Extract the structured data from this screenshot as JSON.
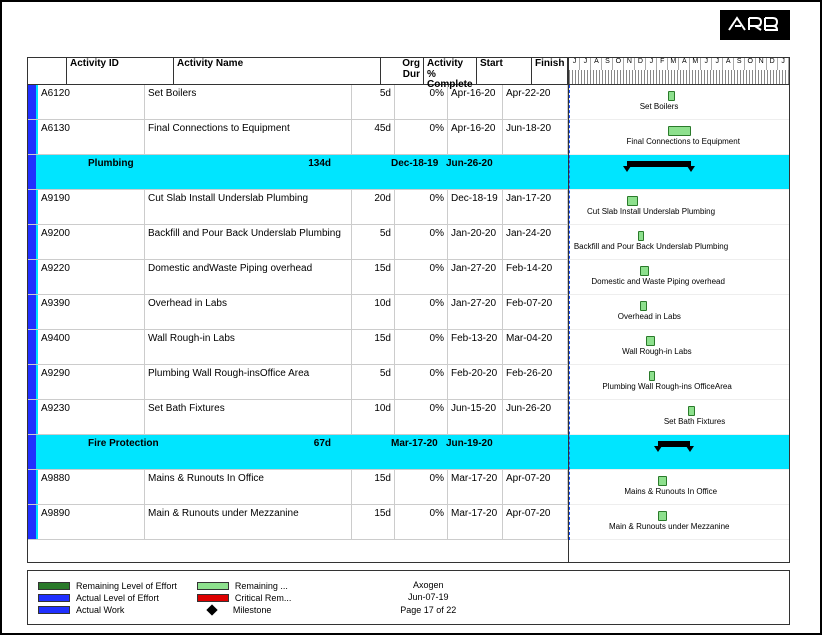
{
  "header": {
    "cols": {
      "id": "Activity ID",
      "name": "Activity Name",
      "dur": "Org Dur",
      "pct": "Activity % Complete",
      "start": "Start",
      "finish": "Finish"
    }
  },
  "months": [
    "J",
    "J",
    "A",
    "S",
    "O",
    "N",
    "D",
    "J",
    "F",
    "M",
    "A",
    "M",
    "J",
    "J",
    "A",
    "S",
    "O",
    "N",
    "D",
    "J"
  ],
  "rows": [
    {
      "type": "task",
      "id": "A6120",
      "name": "Set Boilers",
      "dur": "5d",
      "pct": "0%",
      "start": "Apr-16-20",
      "finish": "Apr-22-20",
      "bar": {
        "l": 45.0,
        "w": 2.0
      },
      "label": "Set Boilers",
      "labelL": 32
    },
    {
      "type": "task",
      "id": "A6130",
      "name": "Final Connections to Equipment",
      "dur": "45d",
      "pct": "0%",
      "start": "Apr-16-20",
      "finish": "Jun-18-20",
      "bar": {
        "l": 45.0,
        "w": 9.5
      },
      "label": "Final Connections to Equipment",
      "labelL": 26
    },
    {
      "type": "section",
      "name": "Plumbing",
      "dur": "134d",
      "start": "Dec-18-19",
      "finish": "Jun-26-20",
      "sum": {
        "l": 26.0,
        "w": 29.5
      }
    },
    {
      "type": "task",
      "id": "A9190",
      "name": "Cut Slab Install Underslab Plumbing",
      "dur": "20d",
      "pct": "0%",
      "start": "Dec-18-19",
      "finish": "Jan-17-20",
      "bar": {
        "l": 26.0,
        "w": 4.5
      },
      "label": "Cut Slab Install Underslab Plumbing",
      "labelL": 8
    },
    {
      "type": "task",
      "id": "A9200",
      "name": "Backfill and Pour Back Underslab Plumbing",
      "dur": "5d",
      "pct": "0%",
      "start": "Jan-20-20",
      "finish": "Jan-24-20",
      "bar": {
        "l": 31.2,
        "w": 2.0
      },
      "label": "Backfill and Pour Back Underslab Plumbing",
      "labelL": 2
    },
    {
      "type": "task",
      "id": "A9220",
      "name": "Domestic andWaste Piping overhead",
      "dur": "15d",
      "pct": "0%",
      "start": "Jan-27-20",
      "finish": "Feb-14-20",
      "bar": {
        "l": 32.3,
        "w": 3.0
      },
      "label": "Domestic and Waste Piping overhead",
      "labelL": 10
    },
    {
      "type": "task",
      "id": "A9390",
      "name": "Overhead in Labs",
      "dur": "10d",
      "pct": "0%",
      "start": "Jan-27-20",
      "finish": "Feb-07-20",
      "bar": {
        "l": 32.3,
        "w": 2.3
      },
      "label": "Overhead in Labs",
      "labelL": 22
    },
    {
      "type": "task",
      "id": "A9400",
      "name": "Wall Rough-in Labs",
      "dur": "15d",
      "pct": "0%",
      "start": "Feb-13-20",
      "finish": "Mar-04-20",
      "bar": {
        "l": 35.0,
        "w": 3.0
      },
      "label": "Wall Rough-in Labs",
      "labelL": 24
    },
    {
      "type": "task",
      "id": "A9290",
      "name": "Plumbing Wall Rough-insOffice Area",
      "dur": "5d",
      "pct": "0%",
      "start": "Feb-20-20",
      "finish": "Feb-26-20",
      "bar": {
        "l": 36.2,
        "w": 2.0
      },
      "label": "Plumbing Wall Rough-ins OfficeArea",
      "labelL": 15
    },
    {
      "type": "task",
      "id": "A9230",
      "name": "Set Bath Fixtures",
      "dur": "10d",
      "pct": "0%",
      "start": "Jun-15-20",
      "finish": "Jun-26-20",
      "bar": {
        "l": 54.0,
        "w": 2.3
      },
      "label": "Set Bath Fixtures",
      "labelL": 43
    },
    {
      "type": "section",
      "name": "Fire Protection",
      "dur": "67d",
      "start": "Mar-17-20",
      "finish": "Jun-19-20",
      "sum": {
        "l": 40.2,
        "w": 14.5
      }
    },
    {
      "type": "task",
      "id": "A9880",
      "name": "Mains & Runouts In Office",
      "dur": "15d",
      "pct": "0%",
      "start": "Mar-17-20",
      "finish": "Apr-07-20",
      "bar": {
        "l": 40.2,
        "w": 3.3
      },
      "label": "Mains & Runouts In Office",
      "labelL": 25
    },
    {
      "type": "task",
      "id": "A9890",
      "name": "Main & Runouts under Mezzanine",
      "dur": "15d",
      "pct": "0%",
      "start": "Mar-17-20",
      "finish": "Apr-07-20",
      "bar": {
        "l": 40.2,
        "w": 3.3
      },
      "label": "Main & Runouts under Mezzanine",
      "labelL": 18
    }
  ],
  "legend": {
    "left": [
      "Remaining Level of Effort",
      "Actual Level of Effort",
      "Actual Work"
    ],
    "mid": [
      "Remaining ...",
      "Critical Rem...",
      "Milestone"
    ]
  },
  "footer": {
    "project": "Axogen",
    "date": "Jun-07-19",
    "page": "Page 17 of 22"
  },
  "dataDateLeft": 0,
  "chart_data": {
    "type": "gantt",
    "title": "Axogen",
    "data_date": "Jun-07-19",
    "time_axis": {
      "start": "2019-06",
      "end": "2021-01",
      "tick_months": [
        "J",
        "J",
        "A",
        "S",
        "O",
        "N",
        "D",
        "J",
        "F",
        "M",
        "A",
        "M",
        "J",
        "J",
        "A",
        "S",
        "O",
        "N",
        "D",
        "J"
      ]
    },
    "groups": [
      {
        "name": "Plumbing",
        "start": "Dec-18-19",
        "finish": "Jun-26-20",
        "duration_days": 134
      },
      {
        "name": "Fire Protection",
        "start": "Mar-17-20",
        "finish": "Jun-19-20",
        "duration_days": 67
      }
    ],
    "tasks": [
      {
        "id": "A6120",
        "name": "Set Boilers",
        "duration_days": 5,
        "pct_complete": 0,
        "start": "Apr-16-20",
        "finish": "Apr-22-20"
      },
      {
        "id": "A6130",
        "name": "Final Connections to Equipment",
        "duration_days": 45,
        "pct_complete": 0,
        "start": "Apr-16-20",
        "finish": "Jun-18-20"
      },
      {
        "id": "A9190",
        "name": "Cut Slab Install Underslab Plumbing",
        "duration_days": 20,
        "pct_complete": 0,
        "start": "Dec-18-19",
        "finish": "Jan-17-20",
        "group": "Plumbing"
      },
      {
        "id": "A9200",
        "name": "Backfill and Pour Back Underslab Plumbing",
        "duration_days": 5,
        "pct_complete": 0,
        "start": "Jan-20-20",
        "finish": "Jan-24-20",
        "group": "Plumbing"
      },
      {
        "id": "A9220",
        "name": "Domestic and Waste Piping overhead",
        "duration_days": 15,
        "pct_complete": 0,
        "start": "Jan-27-20",
        "finish": "Feb-14-20",
        "group": "Plumbing"
      },
      {
        "id": "A9390",
        "name": "Overhead in Labs",
        "duration_days": 10,
        "pct_complete": 0,
        "start": "Jan-27-20",
        "finish": "Feb-07-20",
        "group": "Plumbing"
      },
      {
        "id": "A9400",
        "name": "Wall Rough-in Labs",
        "duration_days": 15,
        "pct_complete": 0,
        "start": "Feb-13-20",
        "finish": "Mar-04-20",
        "group": "Plumbing"
      },
      {
        "id": "A9290",
        "name": "Plumbing Wall Rough-ins Office Area",
        "duration_days": 5,
        "pct_complete": 0,
        "start": "Feb-20-20",
        "finish": "Feb-26-20",
        "group": "Plumbing"
      },
      {
        "id": "A9230",
        "name": "Set Bath Fixtures",
        "duration_days": 10,
        "pct_complete": 0,
        "start": "Jun-15-20",
        "finish": "Jun-26-20",
        "group": "Plumbing"
      },
      {
        "id": "A9880",
        "name": "Mains & Runouts In Office",
        "duration_days": 15,
        "pct_complete": 0,
        "start": "Mar-17-20",
        "finish": "Apr-07-20",
        "group": "Fire Protection"
      },
      {
        "id": "A9890",
        "name": "Main & Runouts under Mezzanine",
        "duration_days": 15,
        "pct_complete": 0,
        "start": "Mar-17-20",
        "finish": "Apr-07-20",
        "group": "Fire Protection"
      }
    ]
  }
}
